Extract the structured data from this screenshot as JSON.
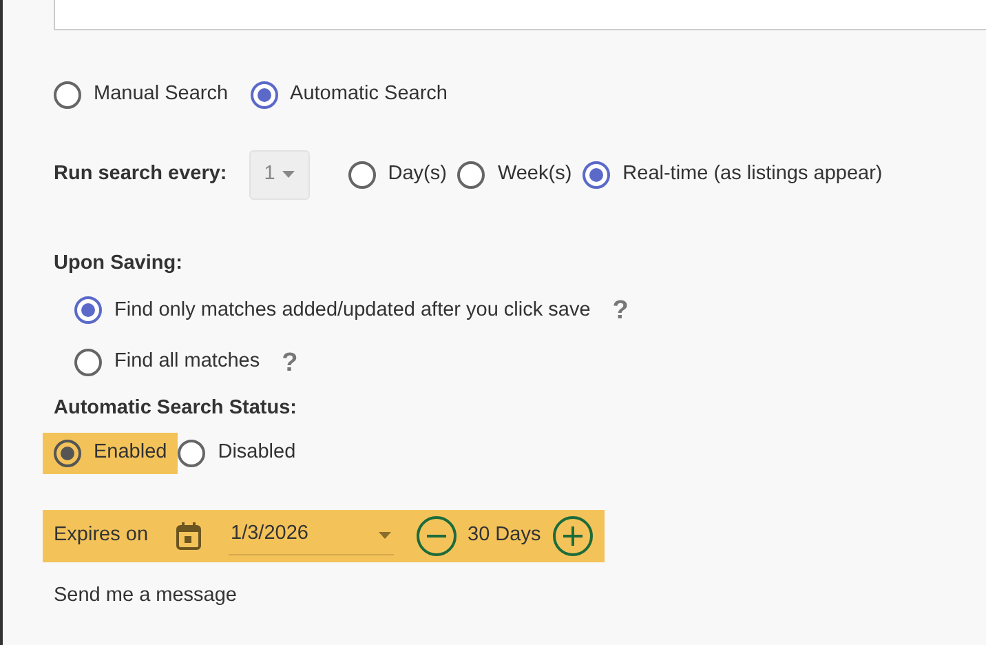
{
  "search_mode": {
    "options": [
      {
        "label": "Manual Search",
        "selected": false
      },
      {
        "label": "Automatic Search",
        "selected": true
      }
    ]
  },
  "run_every": {
    "label": "Run search every:",
    "value": "1",
    "options": [
      {
        "label": "Day(s)",
        "selected": false
      },
      {
        "label": "Week(s)",
        "selected": false
      },
      {
        "label": "Real-time (as listings appear)",
        "selected": true
      }
    ]
  },
  "upon_saving": {
    "label": "Upon Saving:",
    "options": [
      {
        "label": "Find only matches added/updated after you click save",
        "selected": true,
        "help": "?"
      },
      {
        "label": "Find all matches",
        "selected": false,
        "help": "?"
      }
    ]
  },
  "status": {
    "label": "Automatic Search Status:",
    "options": [
      {
        "label": "Enabled",
        "selected": true,
        "highlighted": true
      },
      {
        "label": "Disabled",
        "selected": false,
        "highlighted": false
      }
    ]
  },
  "expiry": {
    "label": "Expires on",
    "date": "1/3/2026",
    "duration": "30 Days",
    "highlighted": true
  },
  "footer_text": "Send me a message"
}
